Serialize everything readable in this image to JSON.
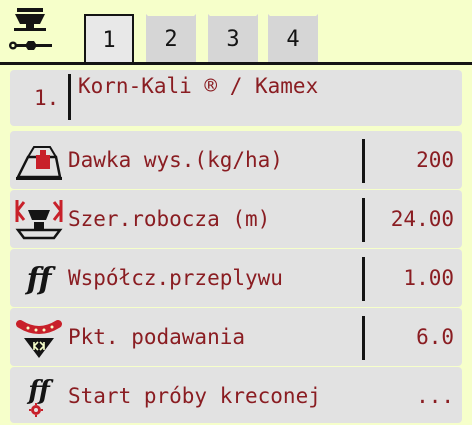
{
  "header": {
    "icon": "spreader-wrench-icon",
    "tabs": [
      "1",
      "2",
      "3",
      "4"
    ],
    "active_tab": 0
  },
  "product": {
    "number": "1.",
    "name": "Korn-Kali ® / Kamex"
  },
  "rows": [
    {
      "icon": "weight-icon",
      "label": "Dawka wys.(kg/ha)",
      "value": "200"
    },
    {
      "icon": "working-width-icon",
      "label": "Szer.robocza (m)",
      "value": "24.00"
    },
    {
      "icon": "flow-factor-icon",
      "label": "Współcz.przeplywu",
      "value": "1.00"
    },
    {
      "icon": "feed-point-icon",
      "label": "Pkt. podawania",
      "value": "6.0"
    },
    {
      "icon": "calibration-test-icon",
      "label": "Start próby kreconej",
      "value": "..."
    }
  ],
  "colors": {
    "background": "#f6ffca",
    "row": "#e2e2e2",
    "text": "#8a1d22",
    "icon_red": "#c8202a"
  }
}
